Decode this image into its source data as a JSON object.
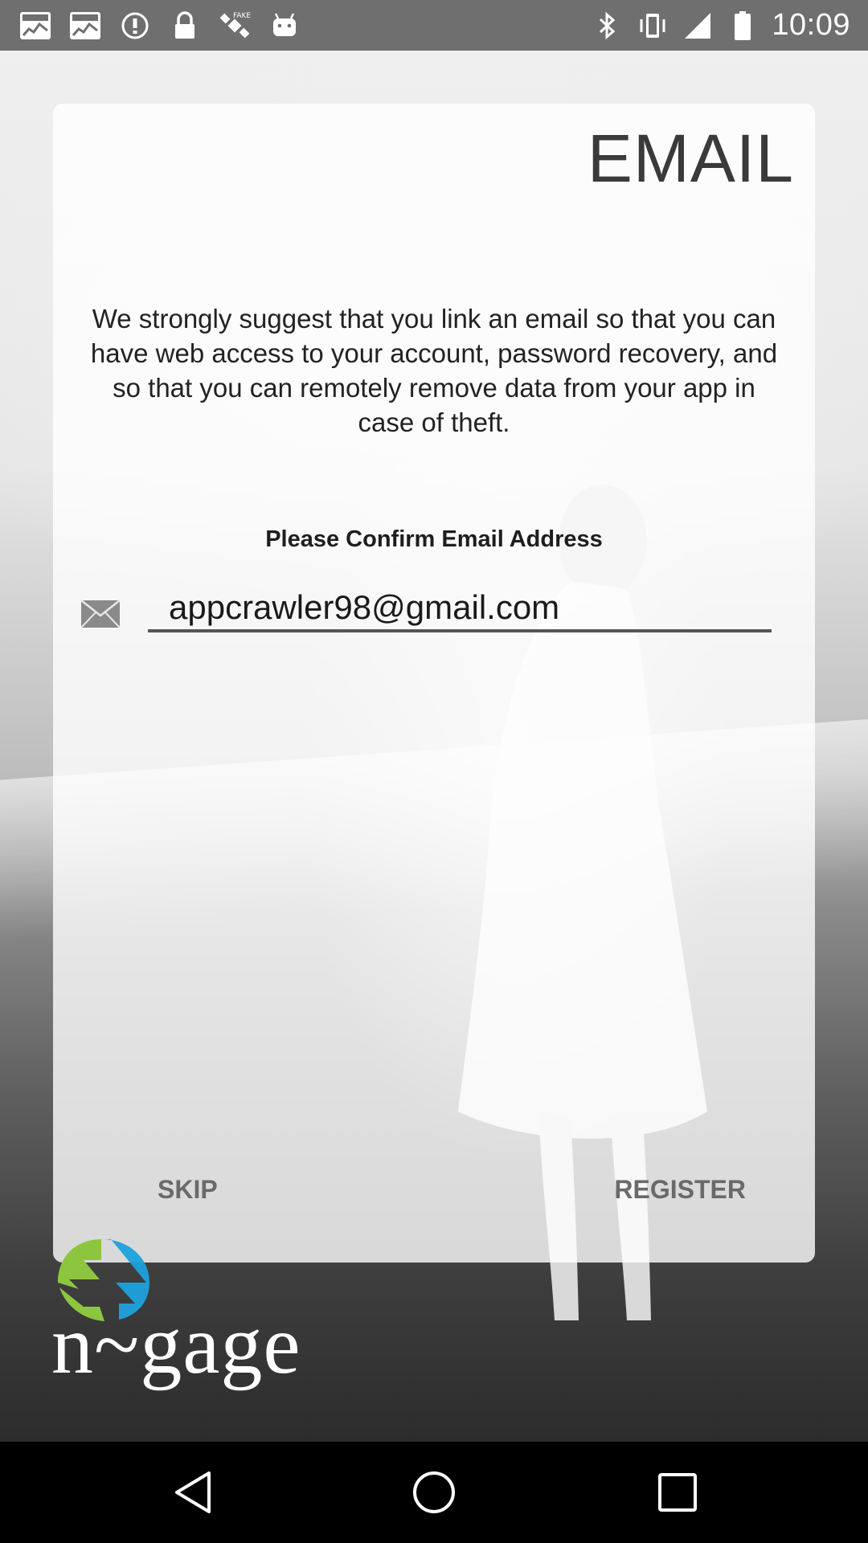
{
  "status_bar": {
    "time": "10:09",
    "left_icons": [
      "market-icon",
      "market-icon",
      "info-icon",
      "lock-icon",
      "satellite-icon",
      "android-icon"
    ],
    "right_icons": [
      "bluetooth-icon",
      "vibrate-icon",
      "signal-icon",
      "battery-icon"
    ]
  },
  "card": {
    "title": "EMAIL",
    "description": "We strongly suggest that you link an email so that you can have web access to your account, password recovery, and so that you can remotely remove data from your app in case of theft.",
    "confirm_label": "Please Confirm Email Address",
    "email_value": "appcrawler98@gmail.com",
    "mail_icon": "envelope-icon",
    "skip_label": "SKIP",
    "register_label": "REGISTER"
  },
  "logo": {
    "text": "n~gage",
    "colors": {
      "green": "#8cc63f",
      "blue": "#1ea1dc"
    }
  },
  "nav_bar": {
    "icons": [
      "back-icon",
      "home-icon",
      "recents-icon"
    ]
  }
}
